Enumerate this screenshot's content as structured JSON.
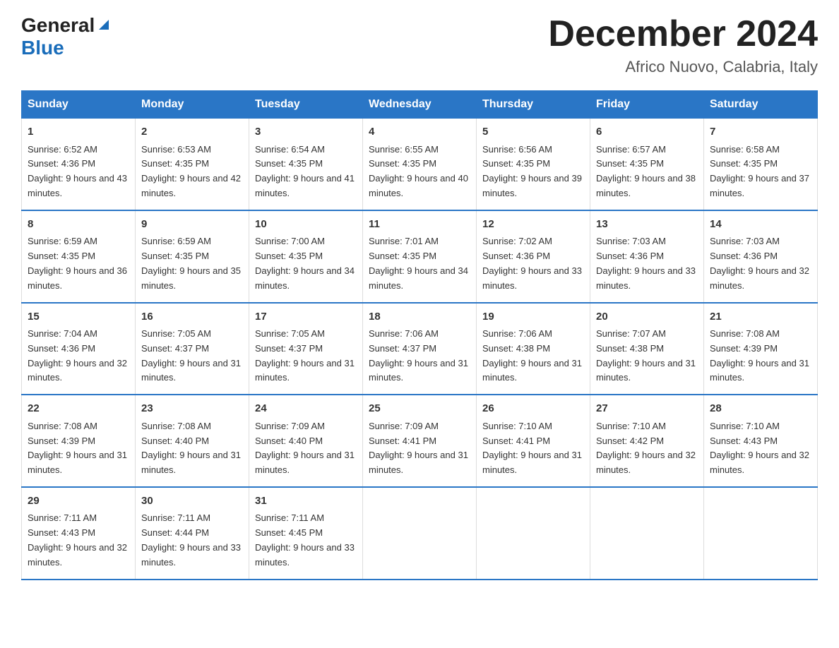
{
  "header": {
    "logo_general": "General",
    "logo_blue": "Blue",
    "month_title": "December 2024",
    "subtitle": "Africo Nuovo, Calabria, Italy"
  },
  "days_of_week": [
    "Sunday",
    "Monday",
    "Tuesday",
    "Wednesday",
    "Thursday",
    "Friday",
    "Saturday"
  ],
  "weeks": [
    [
      {
        "day": "1",
        "sunrise": "6:52 AM",
        "sunset": "4:36 PM",
        "daylight": "9 hours and 43 minutes."
      },
      {
        "day": "2",
        "sunrise": "6:53 AM",
        "sunset": "4:35 PM",
        "daylight": "9 hours and 42 minutes."
      },
      {
        "day": "3",
        "sunrise": "6:54 AM",
        "sunset": "4:35 PM",
        "daylight": "9 hours and 41 minutes."
      },
      {
        "day": "4",
        "sunrise": "6:55 AM",
        "sunset": "4:35 PM",
        "daylight": "9 hours and 40 minutes."
      },
      {
        "day": "5",
        "sunrise": "6:56 AM",
        "sunset": "4:35 PM",
        "daylight": "9 hours and 39 minutes."
      },
      {
        "day": "6",
        "sunrise": "6:57 AM",
        "sunset": "4:35 PM",
        "daylight": "9 hours and 38 minutes."
      },
      {
        "day": "7",
        "sunrise": "6:58 AM",
        "sunset": "4:35 PM",
        "daylight": "9 hours and 37 minutes."
      }
    ],
    [
      {
        "day": "8",
        "sunrise": "6:59 AM",
        "sunset": "4:35 PM",
        "daylight": "9 hours and 36 minutes."
      },
      {
        "day": "9",
        "sunrise": "6:59 AM",
        "sunset": "4:35 PM",
        "daylight": "9 hours and 35 minutes."
      },
      {
        "day": "10",
        "sunrise": "7:00 AM",
        "sunset": "4:35 PM",
        "daylight": "9 hours and 34 minutes."
      },
      {
        "day": "11",
        "sunrise": "7:01 AM",
        "sunset": "4:35 PM",
        "daylight": "9 hours and 34 minutes."
      },
      {
        "day": "12",
        "sunrise": "7:02 AM",
        "sunset": "4:36 PM",
        "daylight": "9 hours and 33 minutes."
      },
      {
        "day": "13",
        "sunrise": "7:03 AM",
        "sunset": "4:36 PM",
        "daylight": "9 hours and 33 minutes."
      },
      {
        "day": "14",
        "sunrise": "7:03 AM",
        "sunset": "4:36 PM",
        "daylight": "9 hours and 32 minutes."
      }
    ],
    [
      {
        "day": "15",
        "sunrise": "7:04 AM",
        "sunset": "4:36 PM",
        "daylight": "9 hours and 32 minutes."
      },
      {
        "day": "16",
        "sunrise": "7:05 AM",
        "sunset": "4:37 PM",
        "daylight": "9 hours and 31 minutes."
      },
      {
        "day": "17",
        "sunrise": "7:05 AM",
        "sunset": "4:37 PM",
        "daylight": "9 hours and 31 minutes."
      },
      {
        "day": "18",
        "sunrise": "7:06 AM",
        "sunset": "4:37 PM",
        "daylight": "9 hours and 31 minutes."
      },
      {
        "day": "19",
        "sunrise": "7:06 AM",
        "sunset": "4:38 PM",
        "daylight": "9 hours and 31 minutes."
      },
      {
        "day": "20",
        "sunrise": "7:07 AM",
        "sunset": "4:38 PM",
        "daylight": "9 hours and 31 minutes."
      },
      {
        "day": "21",
        "sunrise": "7:08 AM",
        "sunset": "4:39 PM",
        "daylight": "9 hours and 31 minutes."
      }
    ],
    [
      {
        "day": "22",
        "sunrise": "7:08 AM",
        "sunset": "4:39 PM",
        "daylight": "9 hours and 31 minutes."
      },
      {
        "day": "23",
        "sunrise": "7:08 AM",
        "sunset": "4:40 PM",
        "daylight": "9 hours and 31 minutes."
      },
      {
        "day": "24",
        "sunrise": "7:09 AM",
        "sunset": "4:40 PM",
        "daylight": "9 hours and 31 minutes."
      },
      {
        "day": "25",
        "sunrise": "7:09 AM",
        "sunset": "4:41 PM",
        "daylight": "9 hours and 31 minutes."
      },
      {
        "day": "26",
        "sunrise": "7:10 AM",
        "sunset": "4:41 PM",
        "daylight": "9 hours and 31 minutes."
      },
      {
        "day": "27",
        "sunrise": "7:10 AM",
        "sunset": "4:42 PM",
        "daylight": "9 hours and 32 minutes."
      },
      {
        "day": "28",
        "sunrise": "7:10 AM",
        "sunset": "4:43 PM",
        "daylight": "9 hours and 32 minutes."
      }
    ],
    [
      {
        "day": "29",
        "sunrise": "7:11 AM",
        "sunset": "4:43 PM",
        "daylight": "9 hours and 32 minutes."
      },
      {
        "day": "30",
        "sunrise": "7:11 AM",
        "sunset": "4:44 PM",
        "daylight": "9 hours and 33 minutes."
      },
      {
        "day": "31",
        "sunrise": "7:11 AM",
        "sunset": "4:45 PM",
        "daylight": "9 hours and 33 minutes."
      },
      {
        "day": "",
        "sunrise": "",
        "sunset": "",
        "daylight": ""
      },
      {
        "day": "",
        "sunrise": "",
        "sunset": "",
        "daylight": ""
      },
      {
        "day": "",
        "sunrise": "",
        "sunset": "",
        "daylight": ""
      },
      {
        "day": "",
        "sunrise": "",
        "sunset": "",
        "daylight": ""
      }
    ]
  ],
  "labels": {
    "sunrise_prefix": "Sunrise: ",
    "sunset_prefix": "Sunset: ",
    "daylight_prefix": "Daylight: "
  }
}
